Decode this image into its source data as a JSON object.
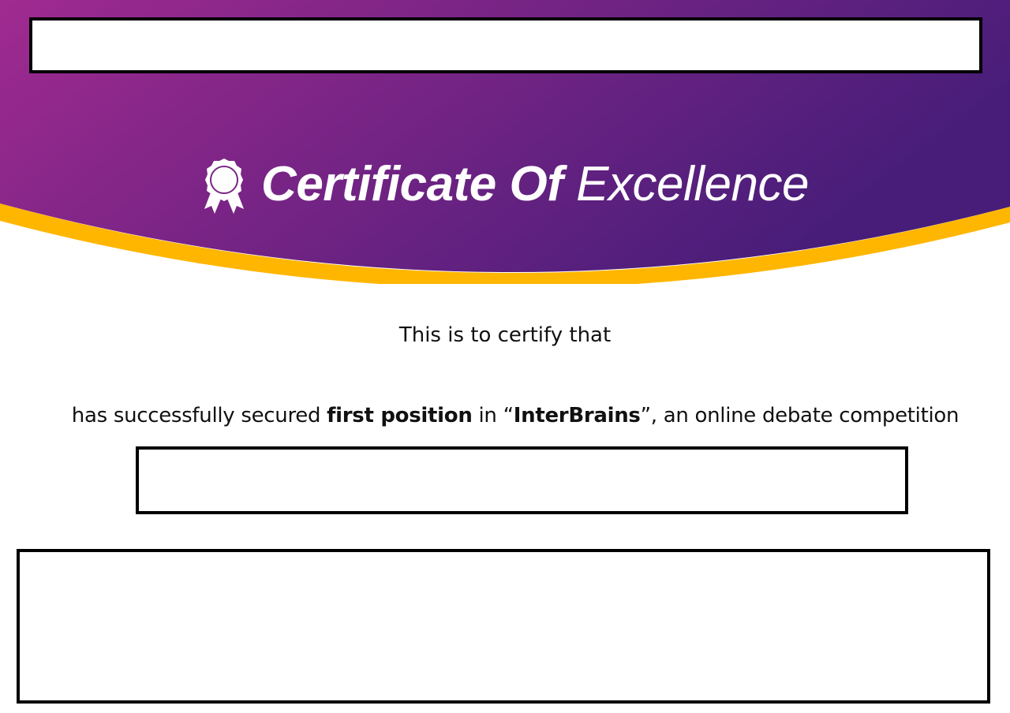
{
  "colors": {
    "header_gradient_start": "#9b2a8f",
    "header_gradient_end": "#4d1f7a",
    "accent_gold": "#ffb600",
    "text": "#111111",
    "title": "#ffffff"
  },
  "header": {
    "icon": "award-ribbon-icon",
    "title_bold": "Certificate Of",
    "title_light": "Excellence"
  },
  "body": {
    "certify_text": "This is to certify that",
    "achievement": {
      "prefix": "has successfully secured ",
      "position": "first position",
      "middle": " in “",
      "competition": "InterBrains",
      "suffix": "”, an online debate competition"
    }
  }
}
